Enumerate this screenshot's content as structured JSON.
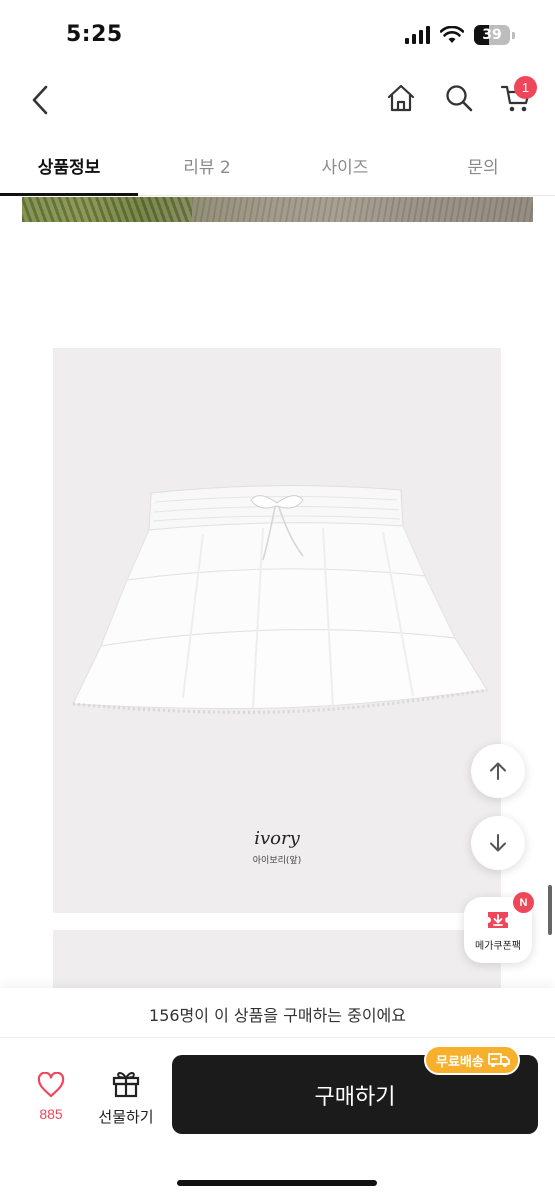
{
  "status_bar": {
    "time": "5:25",
    "battery": "39"
  },
  "header": {
    "cart_count": "1"
  },
  "tabs": [
    {
      "label": "상품정보"
    },
    {
      "label": "리뷰 2"
    },
    {
      "label": "사이즈"
    },
    {
      "label": "문의"
    }
  ],
  "product_image": {
    "color_name": "ivory",
    "color_sub": "아이보리(앞)"
  },
  "coupon": {
    "label": "메가쿠폰팩",
    "badge": "N"
  },
  "purchase_notice": "156명이 이 상품을 구매하는 중이에요",
  "bottom": {
    "like_count": "885",
    "gift_label": "선물하기",
    "buy_label": "구매하기",
    "free_shipping": "무료배송"
  },
  "colors": {
    "accent": "#f0465a",
    "buy_button": "#1b1b1b",
    "shipping_badge": "#f7b02b"
  }
}
